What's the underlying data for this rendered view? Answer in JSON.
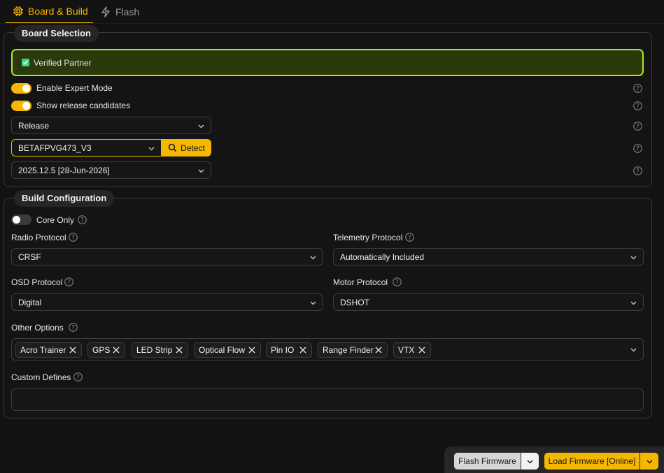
{
  "tabs": [
    {
      "label": "Board & Build",
      "active": true,
      "icon": "chip-icon"
    },
    {
      "label": "Flash",
      "active": false,
      "icon": "lightning-icon"
    }
  ],
  "board_selection": {
    "title": "Board Selection",
    "verified_partner": {
      "label": "Verified Partner",
      "checked": true
    },
    "expert_mode": {
      "label": "Enable Expert Mode",
      "on": true
    },
    "release_candidates": {
      "label": "Show release candidates",
      "on": true
    },
    "release_select": {
      "value": "Release"
    },
    "board_select": {
      "value": "BETAFPVG473_V3"
    },
    "detect_button": "Detect",
    "version_select": {
      "value": "2025.12.5 [28-Jun-2026]"
    }
  },
  "build_configuration": {
    "title": "Build Configuration",
    "core_only": {
      "label": "Core Only",
      "on": false
    },
    "radio_protocol": {
      "label": "Radio Protocol",
      "value": "CRSF"
    },
    "telemetry_protocol": {
      "label": "Telemetry Protocol",
      "value": "Automatically Included"
    },
    "osd_protocol": {
      "label": "OSD Protocol",
      "value": "Digital"
    },
    "motor_protocol": {
      "label": "Motor Protocol",
      "value": "DSHOT"
    },
    "other_options": {
      "label": "Other Options",
      "chips": [
        "Acro Trainer",
        "GPS",
        "LED Strip",
        "Optical Flow",
        "Pin IO",
        "Range Finder",
        "VTX"
      ]
    },
    "custom_defines": {
      "label": "Custom Defines",
      "value": ""
    }
  },
  "actions": {
    "flash_firmware": "Flash Firmware",
    "load_firmware": "Load Firmware [Online]"
  },
  "colors": {
    "accent": "#f5b700",
    "partner_border": "#b3e22a",
    "partner_bg": "#2a3a0a",
    "background": "#121212"
  }
}
